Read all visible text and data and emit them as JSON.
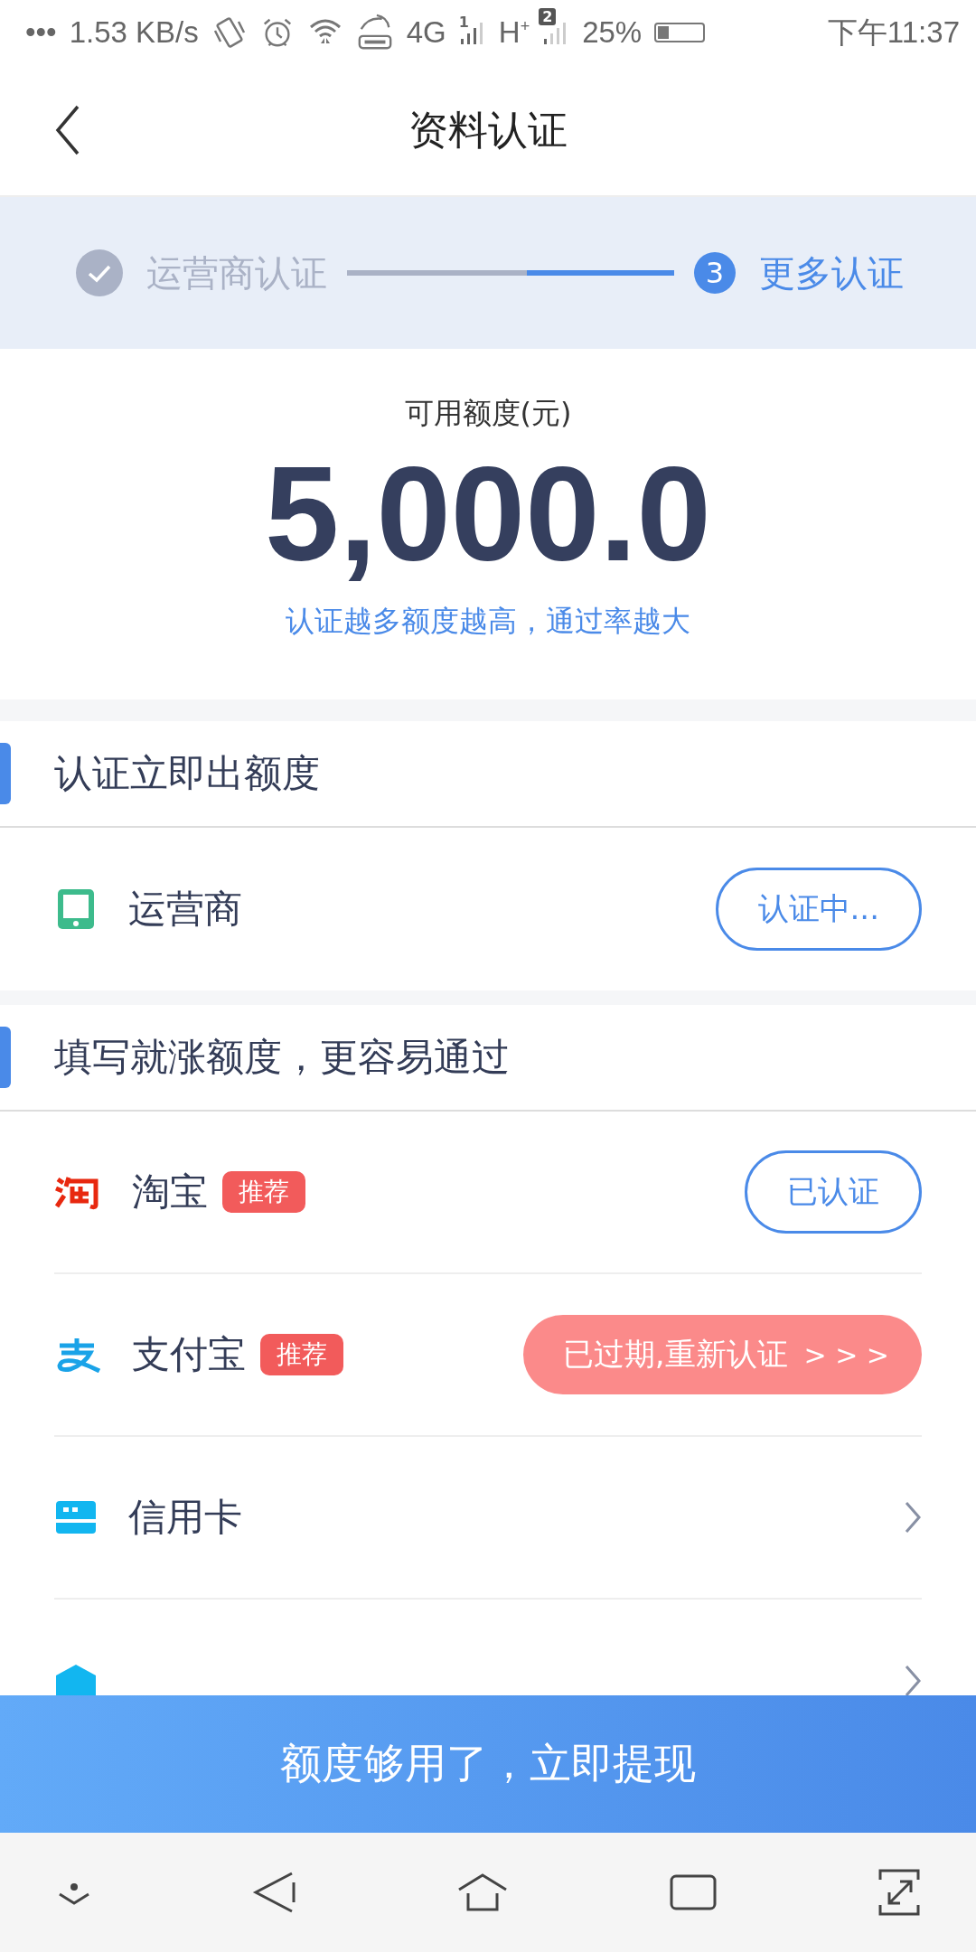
{
  "status_bar": {
    "dots": "•••",
    "network_speed": "1.53 KB/s",
    "network_type": "4G",
    "sim1_label": "1",
    "sim2_type": "H$^{+}$",
    "sim2_badge": "2",
    "battery": "25%",
    "time": "下午11:37"
  },
  "header": {
    "title": "资料认证"
  },
  "steps": [
    {
      "label": "运营商认证",
      "completed": true
    },
    {
      "label": "更多认证",
      "number": "3",
      "completed": false
    }
  ],
  "step_connector": {
    "level": 0.55
  },
  "quota": {
    "label": "可用额度(元)",
    "amount": "5,000.0",
    "hint": "认证越多额度越高，通过率越大"
  },
  "sections": [
    {
      "title": "认证立即出额度",
      "items": [
        {
          "kind": "phone",
          "name": "运营商",
          "action": {
            "kind": "pending",
            "label": "认证中..."
          }
        }
      ]
    },
    {
      "title": "填写就涨额度，更容易通过",
      "items": [
        {
          "kind": "taobao",
          "name": "淘宝",
          "badge": "推荐",
          "action": {
            "kind": "done",
            "label": "已认证"
          }
        },
        {
          "kind": "alipay",
          "name": "支付宝",
          "badge": "推荐",
          "action": {
            "kind": "expired",
            "label": "已过期,重新认证",
            "arrows": "> > >"
          }
        },
        {
          "kind": "card",
          "name": "信用卡",
          "action": {
            "kind": "arrow"
          }
        },
        {
          "kind": "bank",
          "action": {
            "kind": "arrow"
          }
        }
      ]
    }
  ],
  "cta": {
    "label": "额度够用了，立即提现"
  }
}
